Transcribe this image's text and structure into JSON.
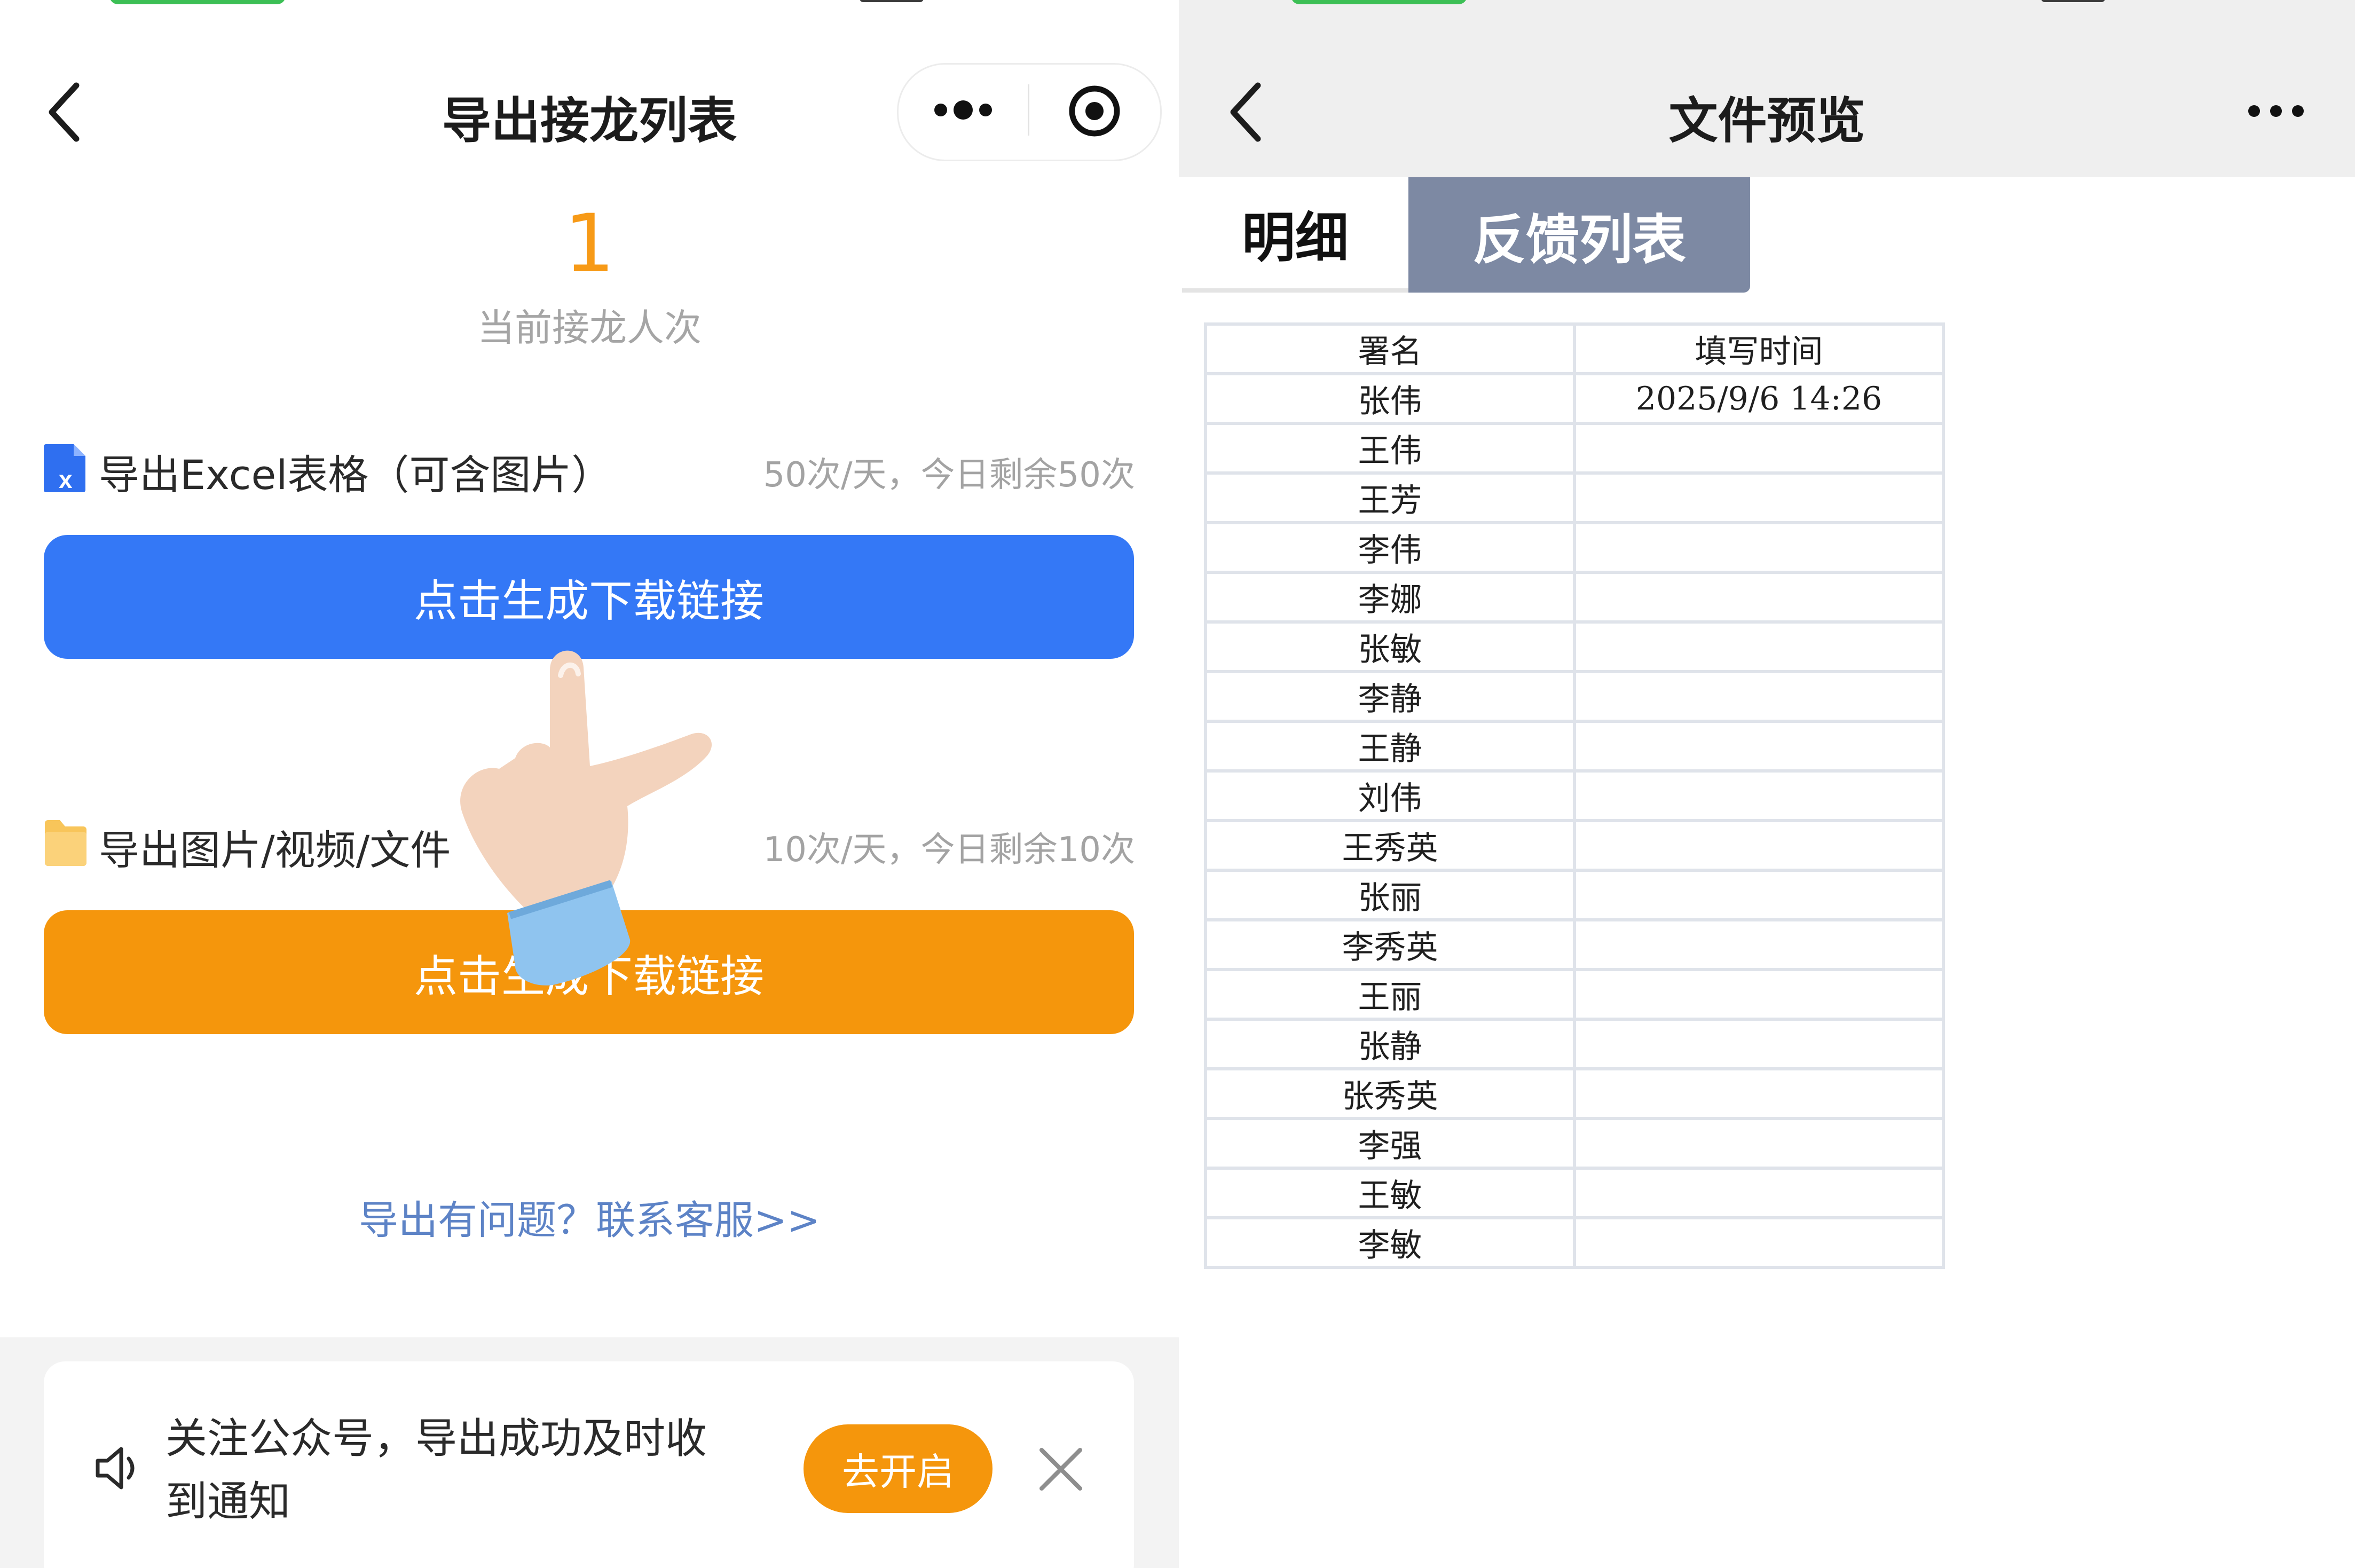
{
  "left": {
    "header": {
      "title": "导出接龙列表",
      "more_icon": "more-dots-icon",
      "record_icon": "record-target-icon"
    },
    "summary": {
      "count": "1",
      "count_label": "当前接龙人次"
    },
    "excel_section": {
      "label": "导出Excel表格（可含图片）",
      "quota": "50次/天，今日剩余50次",
      "button_label": "点击生成下载链接",
      "icon": "excel-file-icon",
      "button_color": "#3478f6"
    },
    "media_section": {
      "label": "导出图片/视频/文件",
      "quota": "10次/天，今日剩余10次",
      "button_label": "点击生成下载链接",
      "icon": "folder-icon",
      "button_color": "#f5960c"
    },
    "help_link": "导出有问题？联系客服>>",
    "notice": {
      "line1": "关注公众号，导出成功及时收",
      "line2": "到通知",
      "button_label": "去开启",
      "icon": "speaker-icon",
      "close_icon": "close-icon"
    }
  },
  "right": {
    "header": {
      "title": "文件预览",
      "more_icon": "more-dots-icon"
    },
    "tabs": [
      {
        "label": "明细",
        "active": true
      },
      {
        "label": "反馈列表",
        "active": false
      }
    ],
    "table": {
      "headers": [
        "署名",
        "填写时间"
      ],
      "rows": [
        [
          "张伟",
          "2025/9/6 14:26"
        ],
        [
          "王伟",
          ""
        ],
        [
          "王芳",
          ""
        ],
        [
          "李伟",
          ""
        ],
        [
          "李娜",
          ""
        ],
        [
          "张敏",
          ""
        ],
        [
          "李静",
          ""
        ],
        [
          "王静",
          ""
        ],
        [
          "刘伟",
          ""
        ],
        [
          "王秀英",
          ""
        ],
        [
          "张丽",
          ""
        ],
        [
          "李秀英",
          ""
        ],
        [
          "王丽",
          ""
        ],
        [
          "张静",
          ""
        ],
        [
          "张秀英",
          ""
        ],
        [
          "李强",
          ""
        ],
        [
          "王敏",
          ""
        ],
        [
          "李敏",
          ""
        ]
      ]
    }
  },
  "overlay": {
    "icon": "pointing-hand-icon"
  },
  "colors": {
    "accent_orange": "#f79a17",
    "accent_blue": "#3478f6",
    "tab_inactive": "#7d89a3"
  }
}
